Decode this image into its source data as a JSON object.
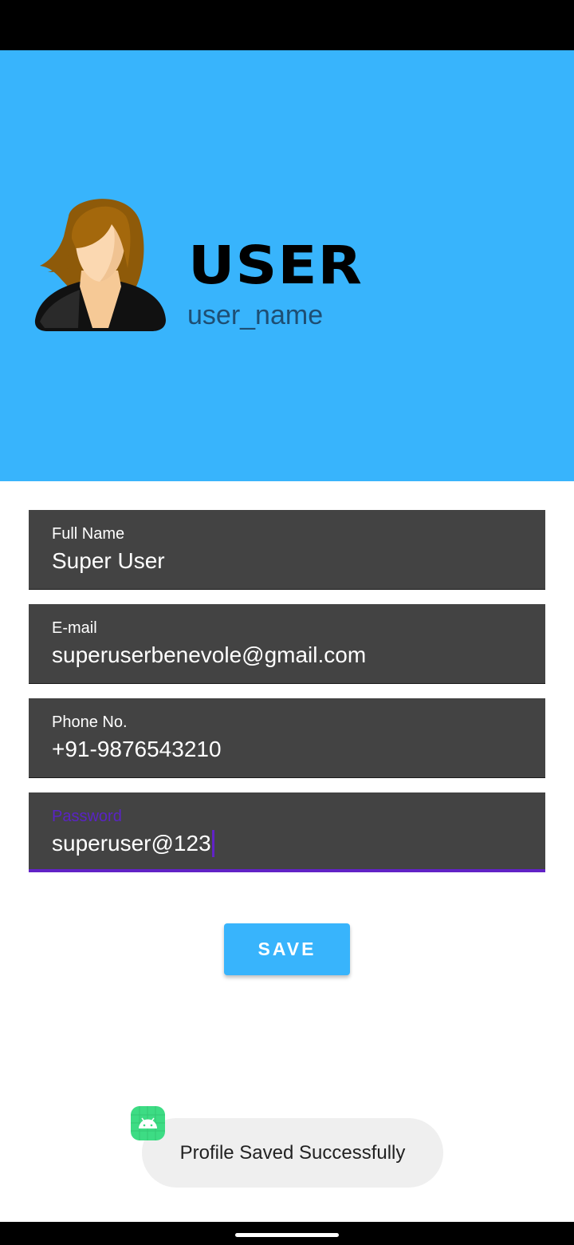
{
  "header": {
    "display_name": "USER",
    "username": "user_name",
    "background_color": "#38b4fc"
  },
  "form": {
    "fields": [
      {
        "label": "Full Name",
        "value": "Super User"
      },
      {
        "label": "E-mail",
        "value": "superuserbenevole@gmail.com"
      },
      {
        "label": "Phone No.",
        "value": "+91-9876543210"
      },
      {
        "label": "Password",
        "value": "superuser@123"
      }
    ],
    "save_label": "SAVE"
  },
  "toast": {
    "message": "Profile Saved Successfully",
    "icon": "android-app-icon"
  },
  "colors": {
    "field_background": "#434343",
    "focus_accent": "#6122c6",
    "button": "#38b4fc"
  }
}
